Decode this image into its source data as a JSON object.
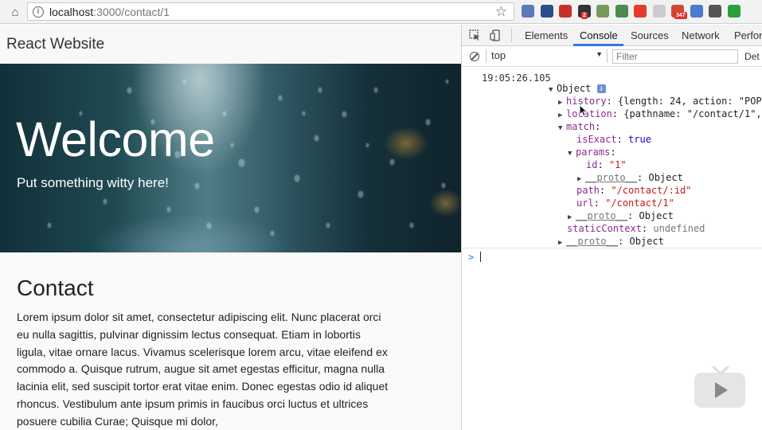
{
  "browser": {
    "url_host": "localhost",
    "url_rest": ":3000/contact/1",
    "extensions": [
      {
        "name": "lastpass-icon",
        "color": "#5a7ab8"
      },
      {
        "name": "feedly-icon",
        "color": "#2a4f8a"
      },
      {
        "name": "acrobat-icon",
        "color": "#c8302b"
      },
      {
        "name": "tampermonkey-icon",
        "color": "#333333",
        "badge": "2"
      },
      {
        "name": "jsonview-icon",
        "color": "#7a9a5a"
      },
      {
        "name": "recycle-icon",
        "color": "#4e8a4e"
      },
      {
        "name": "adblock-icon",
        "color": "#e33b2e"
      },
      {
        "name": "ex-icon",
        "color": "#cccccc"
      },
      {
        "name": "gmail-icon",
        "color": "#d14836",
        "badge": "347"
      },
      {
        "name": "blue-ext-icon",
        "color": "#4a7bd0"
      },
      {
        "name": "settings-ext-icon",
        "color": "#555555"
      },
      {
        "name": "shield-ext-icon",
        "color": "#2aa03a"
      }
    ]
  },
  "page": {
    "brand": "React Website",
    "hero_title": "Welcome",
    "hero_subtitle": "Put something witty here!",
    "heading": "Contact",
    "body": "Lorem ipsum dolor sit amet, consectetur adipiscing elit. Nunc placerat orci eu nulla sagittis, pulvinar dignissim lectus consequat. Etiam in lobortis ligula, vitae ornare lacus. Vivamus scelerisque lorem arcu, vitae eleifend ex commodo a. Quisque rutrum, augue sit amet egestas efficitur, magna nulla lacinia elit, sed suscipit tortor erat vitae enim. Donec egestas odio id aliquet rhoncus. Vestibulum ante ipsum primis in faucibus orci luctus et ultrices posuere cubilia Curae; Quisque mi dolor,"
  },
  "devtools": {
    "tabs": [
      "Elements",
      "Console",
      "Sources",
      "Network",
      "Perfor"
    ],
    "active_tab": "Console",
    "context": "top",
    "filter_placeholder": "Filter",
    "levels": "Det",
    "timestamp": "19:05:26.105",
    "object_label": "Object",
    "info": "i",
    "props": {
      "history_key": "history",
      "history_val": "{length: 24, action: \"POP\",",
      "location_key": "location",
      "location_val": "{pathname: \"/contact/1\", se",
      "match_key": "match",
      "isExact_key": "isExact",
      "isExact_val": "true",
      "params_key": "params",
      "id_key": "id",
      "id_val": "\"1\"",
      "proto_key": "__proto__",
      "proto_val": "Object",
      "path_key": "path",
      "path_val": "\"/contact/:id\"",
      "url_key": "url",
      "url_val": "\"/contact/1\"",
      "staticContext_key": "staticContext",
      "staticContext_val": "undefined"
    },
    "prompt_symbol": ">"
  }
}
